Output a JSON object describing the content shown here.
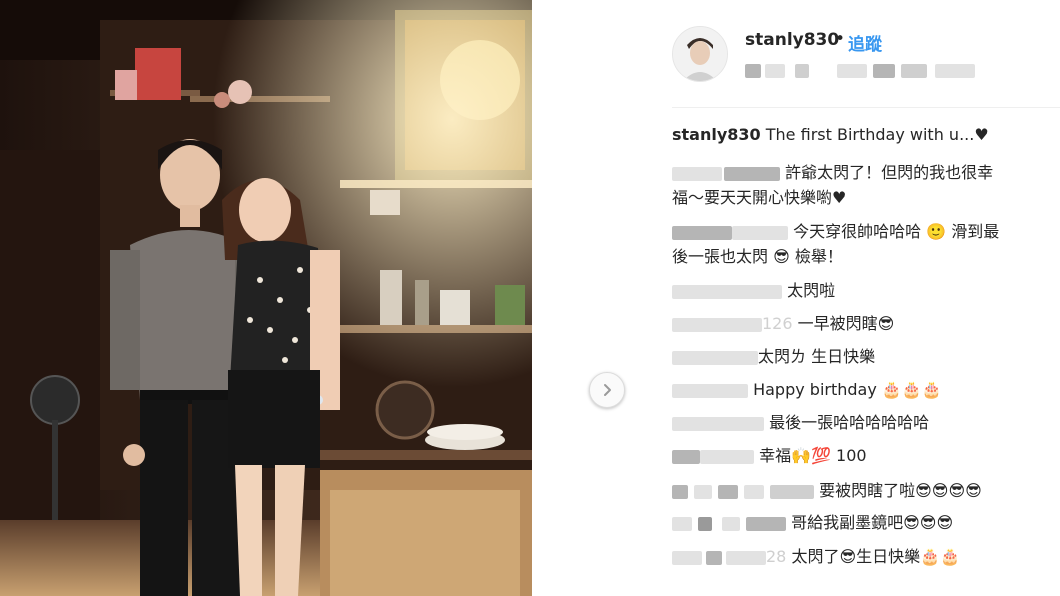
{
  "post": {
    "username": "stanly830",
    "separator": "•",
    "follow_label": "追蹤",
    "caption_user": "stanly830",
    "caption_text": "The first Birthday with u...♥"
  },
  "comments": [
    {
      "text_l1": "許爺太閃了！但閃的我也很幸",
      "text_l2": "福～要天天開心快樂喲♥"
    },
    {
      "text_l1": "今天穿很帥哈哈哈 🙂 滑到最",
      "text_l2": "後一張也太閃 😎 檢舉！"
    },
    {
      "text": "太閃啦"
    },
    {
      "prefix": "126",
      "text": "一早被閃瞎😎"
    },
    {
      "text": "太閃ㄌ 生日快樂"
    },
    {
      "text": "Happy birthday 🎂🎂🎂"
    },
    {
      "text": "最後一張哈哈哈哈哈哈"
    },
    {
      "text": "幸福🙌💯 100"
    },
    {
      "text": "要被閃瞎了啦😎😎😎😎"
    },
    {
      "text": "哥給我副墨鏡吧😎😎😎"
    },
    {
      "prefix": "28",
      "text": "太閃了😎生日快樂🎂🎂"
    }
  ],
  "icons": {
    "next": "chevron-right-icon",
    "avatar": "user-avatar"
  },
  "colors": {
    "link": "#3897f0",
    "text": "#262626"
  }
}
